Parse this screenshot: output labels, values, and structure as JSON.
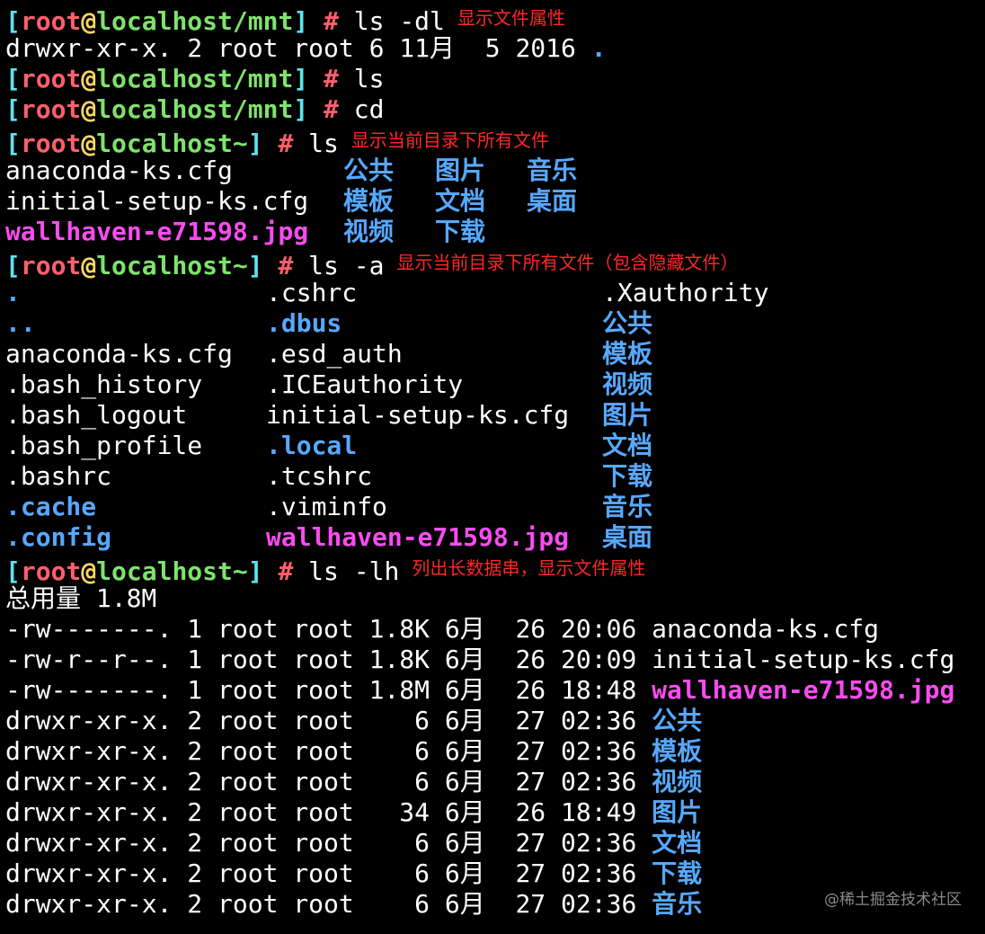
{
  "prompt": {
    "open": "[",
    "user": "root",
    "at": "@",
    "host": "localhost",
    "close": "]",
    "hash": "#"
  },
  "lines": {
    "l1": {
      "path": "/mnt",
      "cmd": "ls -dl",
      "note": "显示文件属性"
    },
    "l2": {
      "text": "drwxr-xr-x. 2 root root 6 11月  5 2016 ",
      "dot": "."
    },
    "l3": {
      "path": "/mnt",
      "cmd": "ls"
    },
    "l4": {
      "path": "/mnt",
      "cmd": "cd"
    },
    "l5": {
      "path": "~",
      "cmd": "ls",
      "note": "显示当前目录下所有文件"
    },
    "ls_rows": [
      {
        "a": "anaconda-ks.cfg",
        "b": "公共",
        "c": "图片",
        "d": "音乐"
      },
      {
        "a": "initial-setup-ks.cfg",
        "b": "模板",
        "c": "文档",
        "d": "桌面"
      },
      {
        "a": "wallhaven-e71598.jpg",
        "b": "视频",
        "c": "下载",
        "d": ""
      }
    ],
    "l9": {
      "path": "~",
      "cmd": "ls -a",
      "note": "显示当前目录下所有文件（包含隐藏文件）"
    },
    "lsa_rows": [
      {
        "a": ".",
        "b": ".cshrc",
        "c": ".Xauthority"
      },
      {
        "a": "..",
        "b": ".dbus",
        "c": "公共"
      },
      {
        "a": "anaconda-ks.cfg",
        "b": ".esd_auth",
        "c": "模板"
      },
      {
        "a": ".bash_history",
        "b": ".ICEauthority",
        "c": "视频"
      },
      {
        "a": ".bash_logout",
        "b": "initial-setup-ks.cfg",
        "c": "图片"
      },
      {
        "a": ".bash_profile",
        "b": ".local",
        "c": "文档"
      },
      {
        "a": ".bashrc",
        "b": ".tcshrc",
        "c": "下载"
      },
      {
        "a": ".cache",
        "b": ".viminfo",
        "c": "音乐"
      },
      {
        "a": ".config",
        "b": "wallhaven-e71598.jpg",
        "c": "桌面"
      }
    ],
    "l19": {
      "path": "~",
      "cmd": "ls -lh",
      "note": "列出长数据串，显示文件属性"
    },
    "total": "总用量 1.8M",
    "lsl_rows": [
      {
        "meta": "-rw-------. 1 root root 1.8K 6月  26 20:06 ",
        "name": "anaconda-ks.cfg",
        "kind": "plain"
      },
      {
        "meta": "-rw-r--r--. 1 root root 1.8K 6月  26 20:09 ",
        "name": "initial-setup-ks.cfg",
        "kind": "plain"
      },
      {
        "meta": "-rw-------. 1 root root 1.8M 6月  26 18:48 ",
        "name": "wallhaven-e71598.jpg",
        "kind": "img"
      },
      {
        "meta": "drwxr-xr-x. 2 root root    6 6月  27 02:36 ",
        "name": "公共",
        "kind": "dir"
      },
      {
        "meta": "drwxr-xr-x. 2 root root    6 6月  27 02:36 ",
        "name": "模板",
        "kind": "dir"
      },
      {
        "meta": "drwxr-xr-x. 2 root root    6 6月  27 02:36 ",
        "name": "视频",
        "kind": "dir"
      },
      {
        "meta": "drwxr-xr-x. 2 root root   34 6月  26 18:49 ",
        "name": "图片",
        "kind": "dir"
      },
      {
        "meta": "drwxr-xr-x. 2 root root    6 6月  27 02:36 ",
        "name": "文档",
        "kind": "dir"
      },
      {
        "meta": "drwxr-xr-x. 2 root root    6 6月  27 02:36 ",
        "name": "下载",
        "kind": "dir"
      },
      {
        "meta": "drwxr-xr-x. 2 root root    6 6月  27 02:36 ",
        "name": "音乐",
        "kind": "dir"
      }
    ]
  },
  "watermark": "@稀土掘金技术社区",
  "colors": {
    "background": "#000000",
    "prompt_bracket": "#5ee3ec",
    "prompt_user": "#ff5f6b",
    "prompt_at": "#ffd866",
    "prompt_host": "#7ee36b",
    "directory": "#57a8ff",
    "image_file": "#f84cf0",
    "annotation": "#ff2626"
  }
}
